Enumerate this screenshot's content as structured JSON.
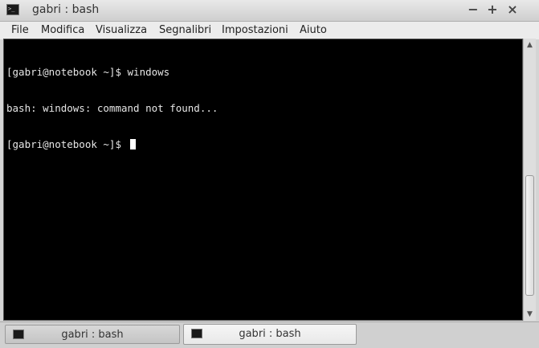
{
  "window": {
    "title": "gabri : bash",
    "app_icon": "terminal-icon",
    "controls": {
      "minimize": "−",
      "maximize": "+",
      "close": "×"
    }
  },
  "menu": {
    "items": [
      "File",
      "Modifica",
      "Visualizza",
      "Segnalibri",
      "Impostazioni",
      "Aiuto"
    ]
  },
  "terminal": {
    "lines": [
      "[gabri@notebook ~]$ windows",
      "bash: windows: command not found...",
      "[gabri@notebook ~]$ "
    ],
    "colors": {
      "background": "#000000",
      "foreground": "#e6e6e6"
    }
  },
  "scrollbar": {
    "up_icon": "arrow-up-icon",
    "down_icon": "arrow-down-icon"
  },
  "tabs": [
    {
      "label": "gabri : bash",
      "icon": "terminal-icon",
      "active": false
    },
    {
      "label": "gabri : bash",
      "icon": "terminal-icon",
      "active": true
    }
  ]
}
